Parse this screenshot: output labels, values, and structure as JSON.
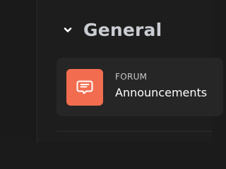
{
  "section": {
    "title": "General",
    "collapse_icon": "chevron-down-icon"
  },
  "channel": {
    "type_label": "FORUM",
    "name": "Announcements",
    "icon": "forum-message-icon",
    "icon_bg": "#f26d50"
  },
  "colors": {
    "background": "#1d1d1d",
    "card": "#262626",
    "title_text": "#c9ccd1",
    "card_title_text": "#ffffff"
  }
}
